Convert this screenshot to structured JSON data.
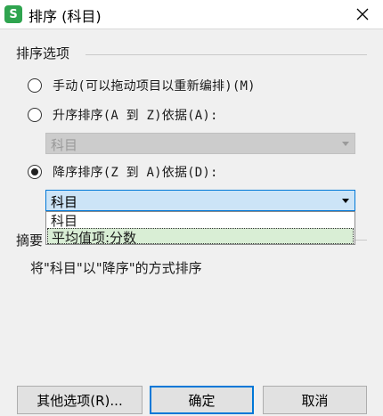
{
  "window": {
    "app_icon_letter": "S",
    "title": "排序 (科目)"
  },
  "sort_options": {
    "group_label": "排序选项",
    "options": [
      {
        "label": "手动(可以拖动项目以重新编排)(M)",
        "selected": false
      },
      {
        "label": "升序排序(A 到 Z)依据(A):",
        "selected": false
      },
      {
        "label": "降序排序(Z 到 A)依据(D):",
        "selected": true
      }
    ],
    "asc_field": {
      "value": "科目",
      "disabled": true
    },
    "desc_field": {
      "value": "科目",
      "expanded": true,
      "options": [
        "科目",
        "平均值项:分数"
      ],
      "highlighted_option": "平均值项:分数"
    }
  },
  "summary": {
    "group_label": "摘要",
    "text": "将\"科目\"以\"降序\"的方式排序"
  },
  "buttons": {
    "other_options": "其他选项(R)...",
    "ok": "确定",
    "cancel": "取消"
  },
  "colors": {
    "app_icon": "#2fa44f",
    "active_select_bg": "#cce4f7",
    "active_select_border": "#0078d7",
    "highlight_option_bg": "#d9eed5"
  }
}
